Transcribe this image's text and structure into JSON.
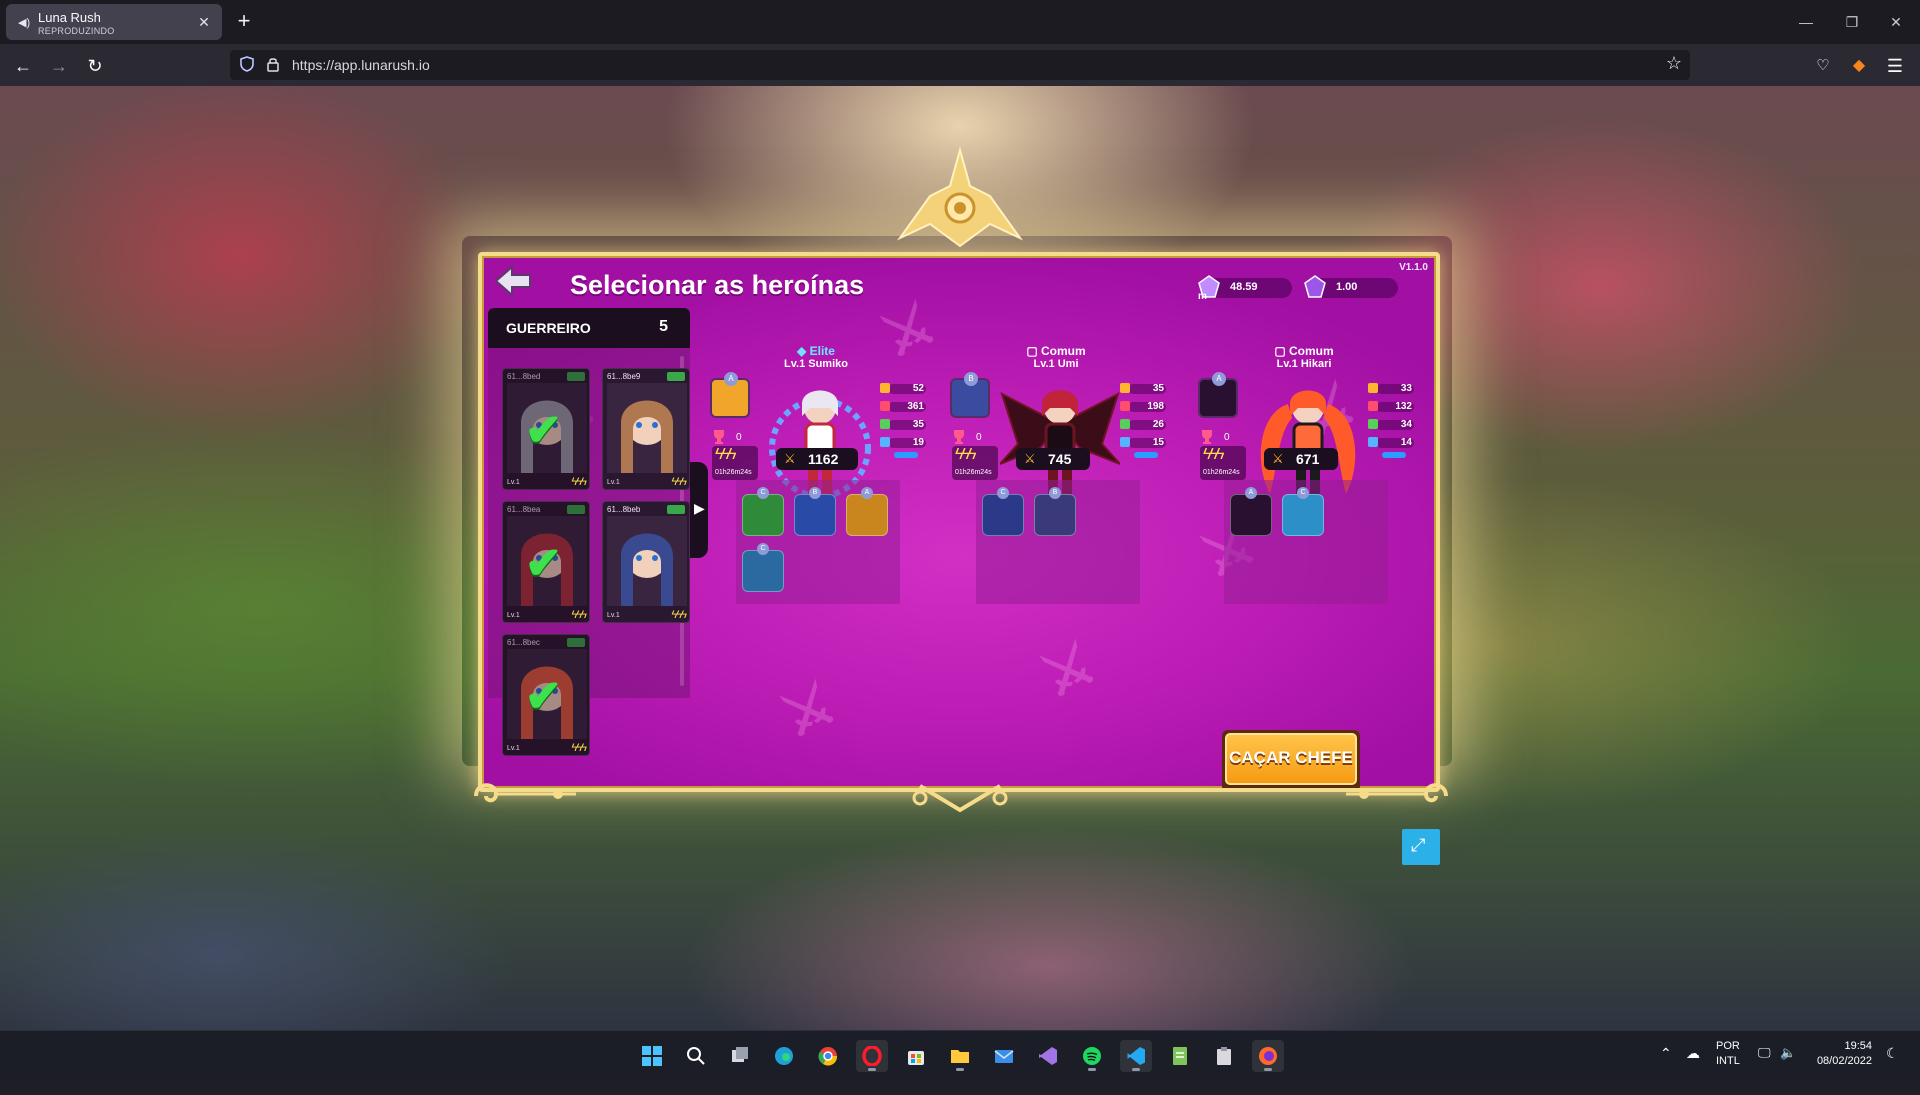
{
  "browser": {
    "tab_title": "Luna Rush",
    "tab_status": "REPRODUZINDO",
    "url": "https://app.lunarush.io"
  },
  "game": {
    "version": "V1.1.0",
    "title": "Selecionar as heroínas",
    "balances": [
      {
        "icon": "luna-m-gem-icon",
        "value": "48.59"
      },
      {
        "icon": "purple-gem-icon",
        "value": "1.00"
      }
    ],
    "class_panel": {
      "label": "GUERREIRO",
      "count": "5"
    },
    "cards": [
      {
        "id": "61...8bed",
        "selected": true,
        "level": "Lv.1",
        "energy": "ϟϟϟ",
        "color": "#9a9aa6"
      },
      {
        "id": "61...8be9",
        "selected": false,
        "level": "Lv.1",
        "energy": "ϟϟϟ",
        "color": "#b07850"
      },
      {
        "id": "61...8bea",
        "selected": true,
        "level": "Lv.1",
        "energy": "ϟϟϟ",
        "color": "#b0303c"
      },
      {
        "id": "61...8beb",
        "selected": false,
        "level": "Lv.1",
        "energy": "ϟϟϟ",
        "color": "#3a4a90"
      },
      {
        "id": "61...8bec",
        "selected": true,
        "level": "Lv.1",
        "energy": "ϟϟϟ",
        "color": "#e25a3c"
      }
    ],
    "heroes": [
      {
        "rarity": "Elite",
        "name": "Lv.1 Sumiko",
        "skill_tag": "A",
        "trophies": "0",
        "energy_time": "01h26m24s",
        "stats": [
          "52",
          "361",
          "35",
          "19"
        ],
        "power": "1162",
        "items": [
          {
            "tag": "C",
            "icon": "green-orb-icon"
          },
          {
            "tag": "B",
            "icon": "blue-orb-icon"
          },
          {
            "tag": "A",
            "icon": "gauntlet-icon"
          },
          {
            "tag": "C",
            "icon": "sword-icon"
          }
        ]
      },
      {
        "rarity": "Comum",
        "name": "Lv.1 Umi",
        "skill_tag": "B",
        "trophies": "0",
        "energy_time": "01h26m24s",
        "stats": [
          "35",
          "198",
          "26",
          "15"
        ],
        "power": "745",
        "items": [
          {
            "tag": "C",
            "icon": "shield-icon"
          },
          {
            "tag": "B",
            "icon": "scythe-icon"
          }
        ]
      },
      {
        "rarity": "Comum",
        "name": "Lv.1 Hikari",
        "skill_tag": "A",
        "trophies": "0",
        "energy_time": "01h26m24s",
        "stats": [
          "33",
          "132",
          "34",
          "14"
        ],
        "power": "671",
        "items": [
          {
            "tag": "A",
            "icon": "demon-mask-icon"
          },
          {
            "tag": "C",
            "icon": "dagger-icon"
          }
        ]
      }
    ],
    "hunt_button": "CAÇAR CHEFE"
  },
  "taskbar": {
    "language": "POR",
    "layout": "INTL",
    "time": "19:54",
    "date": "08/02/2022"
  }
}
